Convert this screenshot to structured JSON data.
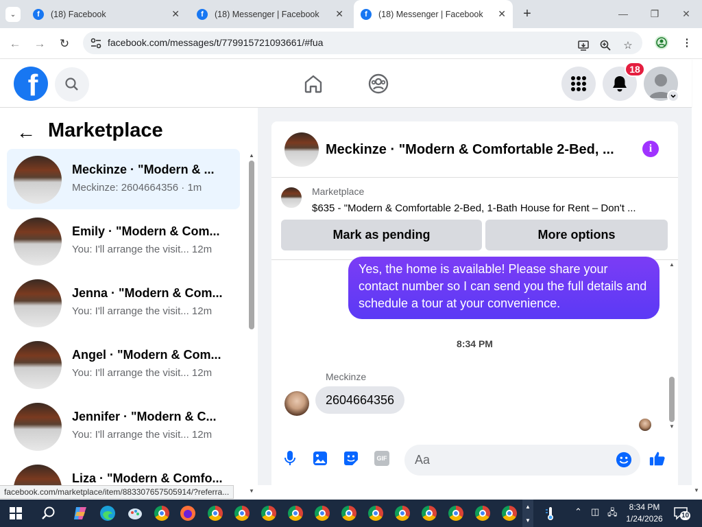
{
  "browser": {
    "tabs": [
      {
        "title": "(18) Facebook",
        "active": false
      },
      {
        "title": "(18) Messenger | Facebook",
        "active": false
      },
      {
        "title": "(18) Messenger | Facebook",
        "active": true
      }
    ],
    "url": "facebook.com/messages/t/779915721093661/#fua",
    "status_url": "facebook.com/marketplace/item/883307657505914/?referra..."
  },
  "fb_header": {
    "logo_letter": "f",
    "notification_count": "18",
    "icons": [
      "search-icon",
      "home-icon",
      "groups-icon",
      "menu-grid-icon",
      "bell-icon",
      "profile-icon"
    ]
  },
  "left_panel": {
    "back_arrow": "←",
    "title": "Marketplace",
    "conversations": [
      {
        "name": "Meckinze · \"Modern & ...",
        "preview": "Meckinze: 2604664356 · 1m",
        "selected": true
      },
      {
        "name": "Emily · \"Modern & Com...",
        "preview": "You: I'll arrange the visit... 12m",
        "selected": false
      },
      {
        "name": "Jenna · \"Modern & Com...",
        "preview": "You: I'll arrange the visit... 12m",
        "selected": false
      },
      {
        "name": "Angel · \"Modern & Com...",
        "preview": "You: I'll arrange the visit... 12m",
        "selected": false
      },
      {
        "name": "Jennifer · \"Modern & C...",
        "preview": "You: I'll arrange the visit... 12m",
        "selected": false
      },
      {
        "name": "Liza · \"Modern & Comfo...",
        "preview": "",
        "selected": false
      }
    ]
  },
  "chat": {
    "title": "Meckinze · \"Modern & Comfortable 2-Bed, ...",
    "info_icon": "i",
    "marketplace_label": "Marketplace",
    "listing": "$635 - \"Modern & Comfortable 2-Bed, 1-Bath House for Rent – Don't ...",
    "mark_pending_label": "Mark as pending",
    "more_options_label": "More options",
    "outgoing_message": "Yes, the home is available! Please share your contact number so I can send you the full details and schedule a tour at your convenience.",
    "timestamp": "8:34 PM",
    "sender_name": "Meckinze",
    "incoming_message": "2604664356",
    "input_placeholder": "Aa",
    "gif_label": "GIF"
  },
  "taskbar": {
    "time": "8:34 PM",
    "date": "1/24/2026",
    "notification_count": "10"
  },
  "colors": {
    "facebook_blue": "#1877f2",
    "messenger_bubble": "#6b3cf5",
    "badge_red": "#e41e3f",
    "taskbar": "#1b2a40"
  }
}
